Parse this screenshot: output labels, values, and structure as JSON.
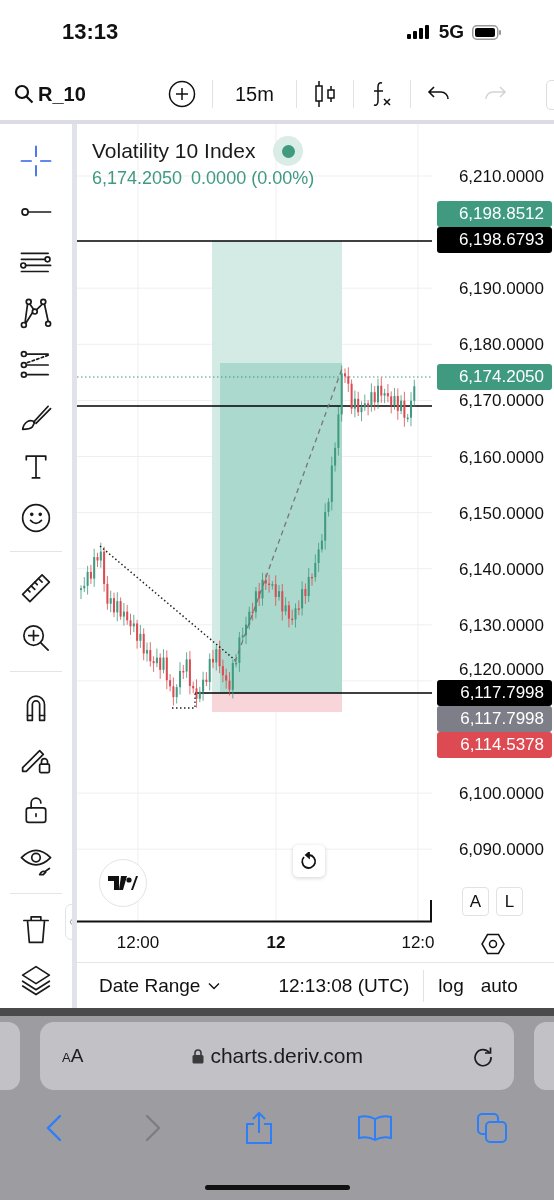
{
  "status_bar": {
    "time": "13:13",
    "network": "5G"
  },
  "toolbar": {
    "symbol": "R_10",
    "interval": "15m",
    "redo_disabled": true
  },
  "drawing_tools": {
    "groups": [
      {
        "tools": [
          {
            "kind": "crosshair",
            "selected": true
          },
          {
            "kind": "line",
            "selected": false
          },
          {
            "kind": "parallel",
            "selected": false
          },
          {
            "kind": "pattern",
            "selected": false
          },
          {
            "kind": "fib",
            "selected": false
          },
          {
            "kind": "brush",
            "selected": false
          },
          {
            "kind": "text",
            "selected": false
          },
          {
            "kind": "emoji",
            "selected": false
          }
        ]
      },
      {
        "tools": [
          {
            "kind": "ruler",
            "selected": false
          },
          {
            "kind": "zoom",
            "selected": false
          }
        ]
      },
      {
        "tools": [
          {
            "kind": "magnet",
            "selected": false
          },
          {
            "kind": "pencil-lock",
            "selected": false
          },
          {
            "kind": "lock",
            "selected": false
          },
          {
            "kind": "eye",
            "selected": false
          }
        ]
      },
      {
        "tools": [
          {
            "kind": "trash",
            "selected": false
          },
          {
            "kind": "layers",
            "selected": false
          }
        ]
      }
    ]
  },
  "chart": {
    "title": "Volatility 10 Index",
    "price": "6,174.2050",
    "change": "0.0000 (0.00%)",
    "price_ticks": [
      "6,210.0000",
      "6,190.0000",
      "6,180.0000",
      "6,170.0000",
      "6,160.0000",
      "6,150.0000",
      "6,140.0000",
      "6,130.0000",
      "6,120.0000",
      "6,100.0000",
      "6,090.0000"
    ],
    "price_badges": [
      {
        "text": "6,198.8512",
        "kind": "marker",
        "color": "#3f9a80"
      },
      {
        "text": "6,198.6793",
        "kind": "line",
        "color": "#000000"
      },
      {
        "text": "6,174.2050",
        "kind": "marker",
        "color": "#3f9a80"
      },
      {
        "text": "6,117.7998",
        "kind": "line",
        "color": "#000000"
      },
      {
        "text": "6,117.7998",
        "kind": "marker",
        "color": "#7e7e88"
      },
      {
        "text": "6,114.5378",
        "kind": "marker",
        "color": "#dd4a52"
      }
    ],
    "time_labels": [
      {
        "text": "12:00",
        "kind": "time"
      },
      {
        "text": "12",
        "kind": "day"
      },
      {
        "text": "12:0",
        "kind": "time"
      }
    ],
    "scale_buttons": [
      "A",
      "L"
    ]
  },
  "footer": {
    "date_range": "Date Range",
    "clock": "12:13:08 (UTC)",
    "log": "log",
    "auto": "auto"
  },
  "browser": {
    "text_size": "AA",
    "url": "charts.deriv.com",
    "forward_disabled": true
  }
}
